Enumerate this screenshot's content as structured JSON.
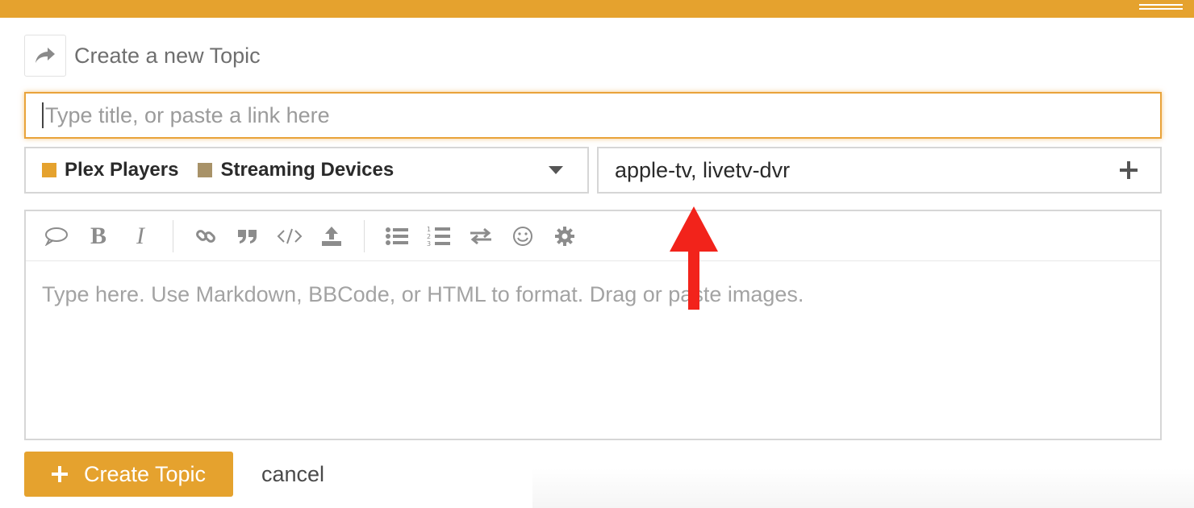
{
  "header": {
    "title": "Create a new Topic",
    "icon": "reply-icon"
  },
  "title_input": {
    "placeholder": "Type title, or paste a link here",
    "value": ""
  },
  "category": {
    "selected": [
      {
        "label": "Plex Players",
        "color": "#e5a22e"
      },
      {
        "label": "Streaming Devices",
        "color": "#a89268"
      }
    ],
    "icon": "chevron-down-icon"
  },
  "tags": {
    "value": "apple-tv, livetv-dvr",
    "icon": "plus-icon"
  },
  "editor": {
    "toolbar": [
      {
        "name": "quote-bubble-icon"
      },
      {
        "name": "bold-icon",
        "text": "B"
      },
      {
        "name": "italic-icon",
        "text": "I"
      },
      {
        "name": "link-icon"
      },
      {
        "name": "blockquote-icon"
      },
      {
        "name": "code-icon"
      },
      {
        "name": "upload-icon"
      },
      {
        "name": "bulleted-list-icon"
      },
      {
        "name": "numbered-list-icon"
      },
      {
        "name": "swap-icon"
      },
      {
        "name": "emoji-icon"
      },
      {
        "name": "gear-icon"
      }
    ],
    "placeholder": "Type here. Use Markdown, BBCode, or HTML to format. Drag or paste images."
  },
  "actions": {
    "create_label": "Create Topic",
    "cancel_label": "cancel"
  },
  "colors": {
    "accent": "#e5a22e",
    "annotation": "#f2231b"
  }
}
